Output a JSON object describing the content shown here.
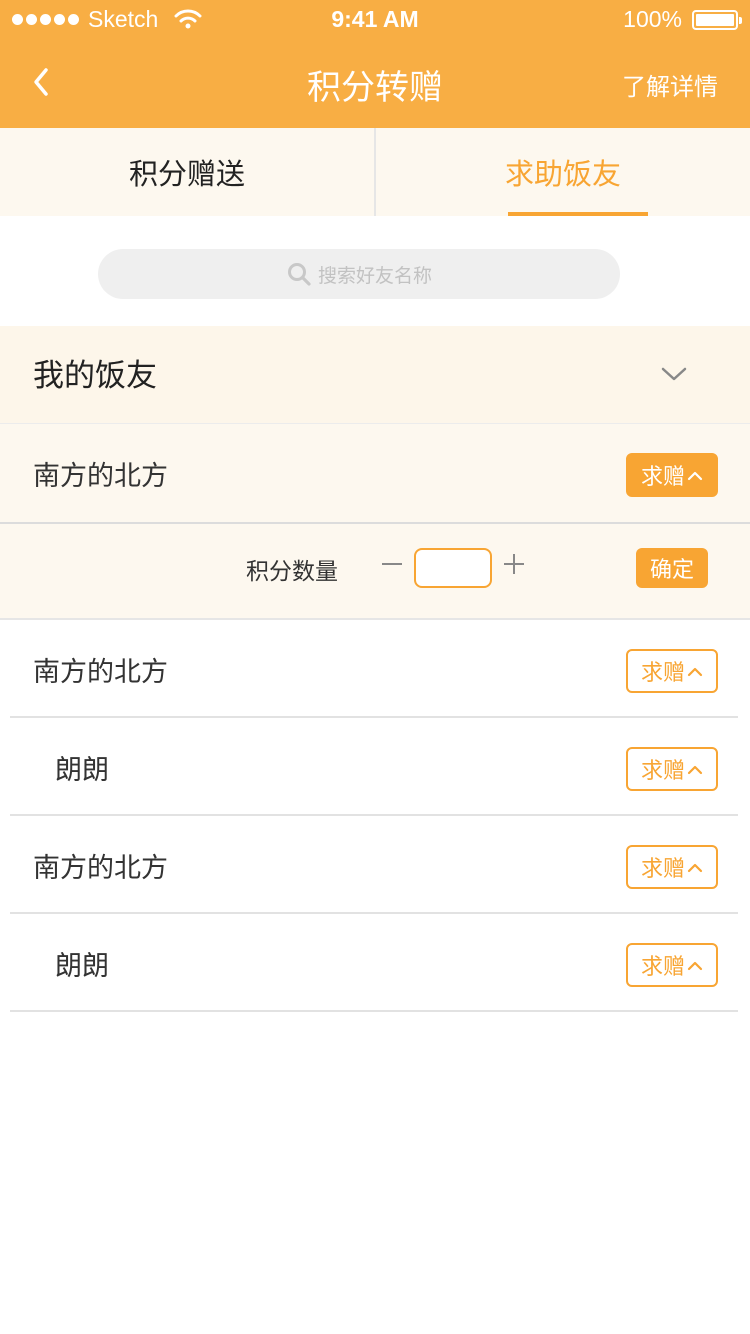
{
  "status_bar": {
    "carrier": "Sketch",
    "time": "9:41 AM",
    "battery": "100%"
  },
  "nav": {
    "title": "积分转赠",
    "right_link": "了解详情",
    "back_icon": "chevron-left-icon"
  },
  "tabs": [
    {
      "label": "积分赠送",
      "active": false
    },
    {
      "label": "求助饭友",
      "active": true
    }
  ],
  "search": {
    "placeholder": "搜索好友名称"
  },
  "group": {
    "label": "我的饭友"
  },
  "rows": [
    {
      "name": "南方的北方",
      "button": "求赠",
      "active": true
    },
    {
      "name": "南方的北方",
      "button": "求赠",
      "active": false
    },
    {
      "name": "朗朗",
      "button": "求赠",
      "active": false
    },
    {
      "name": "南方的北方",
      "button": "求赠",
      "active": false
    },
    {
      "name": "朗朗",
      "button": "求赠",
      "active": false
    }
  ],
  "panel": {
    "label": "积分数量",
    "quantity": "",
    "confirm": "确定"
  },
  "colors": {
    "accent": "#f8a533",
    "nav_bg": "#f8ae44",
    "tab_bg": "#fdf8ef"
  }
}
